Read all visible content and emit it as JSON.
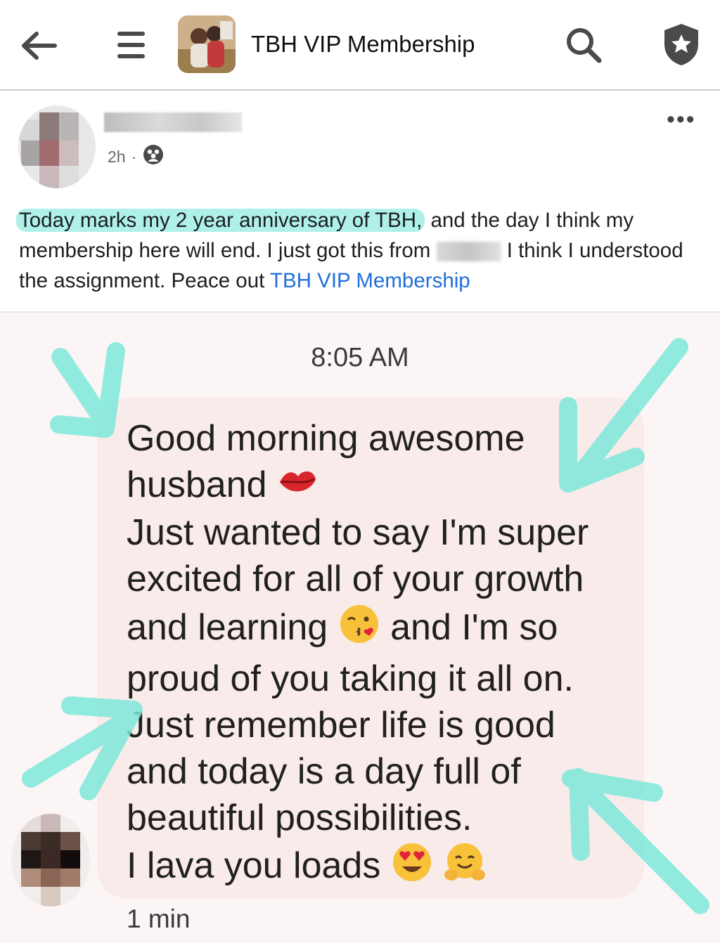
{
  "header": {
    "group_name": "TBH VIP Membership",
    "icons": {
      "back": "back-arrow-icon",
      "menu": "menu-icon",
      "search": "search-icon",
      "admin": "shield-star-icon"
    }
  },
  "post": {
    "time": "2h",
    "separator": "·",
    "audience_icon": "group-audience-icon",
    "text_highlighted": "Today marks my 2 year anniversary of TBH,",
    "text_part1": " and the day I think my membership here will end. I just got this from ",
    "text_part2": " I think I understood the assignment. Peace out ",
    "text_link": "TBH VIP Membership",
    "more_icon": "more-options-icon"
  },
  "message": {
    "timestamp": "8:05 AM",
    "lines": [
      "Good morning awesome",
      "husband",
      "Just wanted to say I'm super",
      "excited for all of your growth",
      "and learning",
      " and I'm so",
      "proud of you taking it all on.",
      "Just remember life is good",
      "and today is a day full of",
      "beautiful possibilities.",
      "I lava you loads"
    ],
    "emojis": [
      "💋",
      "😘",
      "😍",
      "🤗"
    ],
    "relative_time": "1 min"
  },
  "colors": {
    "link": "#216fdb",
    "highlight": "#6ee6d7",
    "annotation_arrow": "#7ee7d9",
    "bubble": "#f8ebe9",
    "screenshot_bg": "#fcf5f6"
  }
}
